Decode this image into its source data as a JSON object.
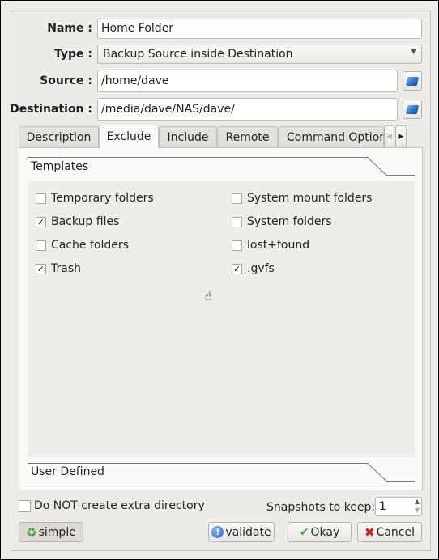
{
  "form": {
    "name_label": "Name :",
    "name_value": "Home Folder",
    "type_label": "Type :",
    "type_value": "Backup Source inside Destination",
    "source_label": "Source :",
    "source_value": "/home/dave",
    "destination_label": "Destination :",
    "destination_value": "/media/dave/NAS/dave/"
  },
  "tabs": [
    {
      "label": "Description"
    },
    {
      "label": "Exclude",
      "active": true
    },
    {
      "label": "Include"
    },
    {
      "label": "Remote"
    },
    {
      "label": "Command Options"
    }
  ],
  "exclude": {
    "templates_header": "Templates",
    "user_defined_header": "User Defined",
    "items": [
      {
        "label": "Temporary folders",
        "checked": false
      },
      {
        "label": "System mount folders",
        "checked": false
      },
      {
        "label": "Backup files",
        "checked": true
      },
      {
        "label": "System folders",
        "checked": false
      },
      {
        "label": "Cache folders",
        "checked": false
      },
      {
        "label": "lost+found",
        "checked": false
      },
      {
        "label": "Trash",
        "checked": true
      },
      {
        "label": ".gvfs",
        "checked": true
      }
    ]
  },
  "bottom": {
    "no_extra_dir_label": "Do NOT create extra directory",
    "no_extra_dir_checked": false,
    "snapshots_label": "Snapshots to keep:",
    "snapshots_value": "1",
    "simple_label": "simple",
    "validate_label": "validate",
    "okay_label": "Okay",
    "cancel_label": "Cancel"
  },
  "colors": {
    "accent_folder": "#2a6cc4",
    "ok_green": "#3aa33a",
    "cancel_red": "#d21f1f",
    "info_blue": "#1f5fd0"
  }
}
